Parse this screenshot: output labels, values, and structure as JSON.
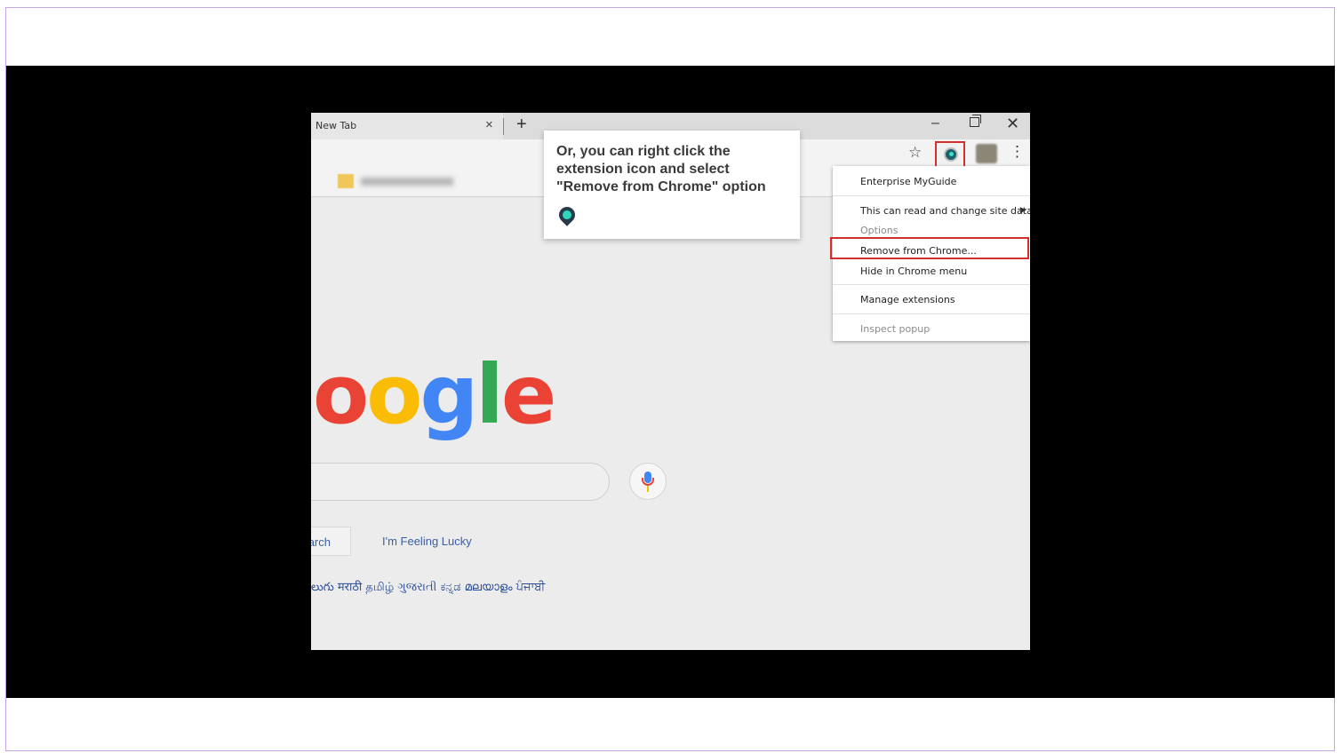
{
  "browser": {
    "tab_title": "New Tab",
    "tab_close": "×",
    "new_tab": "+",
    "minimize": "–",
    "close": "✕",
    "star": "☆",
    "menu_dots": "⋮"
  },
  "context_menu": {
    "title": "Enterprise MyGuide",
    "site_data": "This can read and change site data",
    "submenu_arrow": "▶",
    "options": "Options",
    "remove": "Remove from Chrome...",
    "hide": "Hide in Chrome menu",
    "manage": "Manage extensions",
    "inspect": "Inspect popup"
  },
  "google": {
    "logo_o1": "o",
    "logo_o2": "o",
    "logo_g": "g",
    "logo_l": "l",
    "logo_e": "e",
    "search_button": "arch",
    "lucky_button": "I'm Feeling Lucky",
    "languages": "లుగు  मराठी  தமிழ்  ગુજરાતી  ಕನ್ನಡ  മലയാളം  ਪੰਜਾਬੀ"
  },
  "callout": {
    "text": "Or, you can right click the extension icon and select \"Remove from Chrome\" option"
  },
  "colors": {
    "highlight": "#d32f2f",
    "brand_accent": "#2fd6bb",
    "link": "#3b5ea6"
  }
}
